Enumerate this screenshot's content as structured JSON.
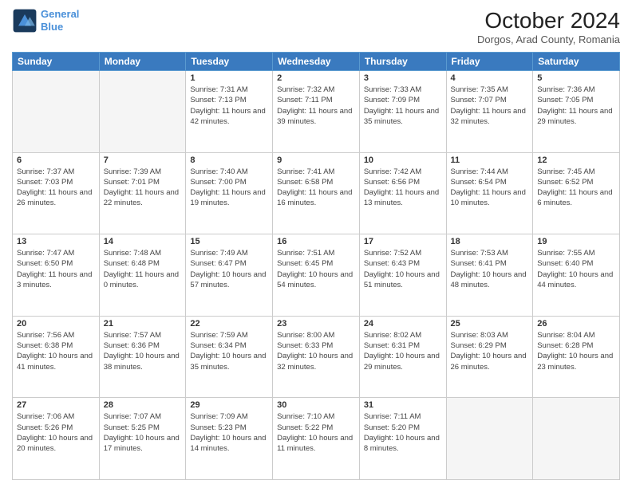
{
  "header": {
    "logo_line1": "General",
    "logo_line2": "Blue",
    "month_title": "October 2024",
    "subtitle": "Dorgos, Arad County, Romania"
  },
  "days_of_week": [
    "Sunday",
    "Monday",
    "Tuesday",
    "Wednesday",
    "Thursday",
    "Friday",
    "Saturday"
  ],
  "weeks": [
    [
      {
        "day": "",
        "info": ""
      },
      {
        "day": "",
        "info": ""
      },
      {
        "day": "1",
        "info": "Sunrise: 7:31 AM\nSunset: 7:13 PM\nDaylight: 11 hours and 42 minutes."
      },
      {
        "day": "2",
        "info": "Sunrise: 7:32 AM\nSunset: 7:11 PM\nDaylight: 11 hours and 39 minutes."
      },
      {
        "day": "3",
        "info": "Sunrise: 7:33 AM\nSunset: 7:09 PM\nDaylight: 11 hours and 35 minutes."
      },
      {
        "day": "4",
        "info": "Sunrise: 7:35 AM\nSunset: 7:07 PM\nDaylight: 11 hours and 32 minutes."
      },
      {
        "day": "5",
        "info": "Sunrise: 7:36 AM\nSunset: 7:05 PM\nDaylight: 11 hours and 29 minutes."
      }
    ],
    [
      {
        "day": "6",
        "info": "Sunrise: 7:37 AM\nSunset: 7:03 PM\nDaylight: 11 hours and 26 minutes."
      },
      {
        "day": "7",
        "info": "Sunrise: 7:39 AM\nSunset: 7:01 PM\nDaylight: 11 hours and 22 minutes."
      },
      {
        "day": "8",
        "info": "Sunrise: 7:40 AM\nSunset: 7:00 PM\nDaylight: 11 hours and 19 minutes."
      },
      {
        "day": "9",
        "info": "Sunrise: 7:41 AM\nSunset: 6:58 PM\nDaylight: 11 hours and 16 minutes."
      },
      {
        "day": "10",
        "info": "Sunrise: 7:42 AM\nSunset: 6:56 PM\nDaylight: 11 hours and 13 minutes."
      },
      {
        "day": "11",
        "info": "Sunrise: 7:44 AM\nSunset: 6:54 PM\nDaylight: 11 hours and 10 minutes."
      },
      {
        "day": "12",
        "info": "Sunrise: 7:45 AM\nSunset: 6:52 PM\nDaylight: 11 hours and 6 minutes."
      }
    ],
    [
      {
        "day": "13",
        "info": "Sunrise: 7:47 AM\nSunset: 6:50 PM\nDaylight: 11 hours and 3 minutes."
      },
      {
        "day": "14",
        "info": "Sunrise: 7:48 AM\nSunset: 6:48 PM\nDaylight: 11 hours and 0 minutes."
      },
      {
        "day": "15",
        "info": "Sunrise: 7:49 AM\nSunset: 6:47 PM\nDaylight: 10 hours and 57 minutes."
      },
      {
        "day": "16",
        "info": "Sunrise: 7:51 AM\nSunset: 6:45 PM\nDaylight: 10 hours and 54 minutes."
      },
      {
        "day": "17",
        "info": "Sunrise: 7:52 AM\nSunset: 6:43 PM\nDaylight: 10 hours and 51 minutes."
      },
      {
        "day": "18",
        "info": "Sunrise: 7:53 AM\nSunset: 6:41 PM\nDaylight: 10 hours and 48 minutes."
      },
      {
        "day": "19",
        "info": "Sunrise: 7:55 AM\nSunset: 6:40 PM\nDaylight: 10 hours and 44 minutes."
      }
    ],
    [
      {
        "day": "20",
        "info": "Sunrise: 7:56 AM\nSunset: 6:38 PM\nDaylight: 10 hours and 41 minutes."
      },
      {
        "day": "21",
        "info": "Sunrise: 7:57 AM\nSunset: 6:36 PM\nDaylight: 10 hours and 38 minutes."
      },
      {
        "day": "22",
        "info": "Sunrise: 7:59 AM\nSunset: 6:34 PM\nDaylight: 10 hours and 35 minutes."
      },
      {
        "day": "23",
        "info": "Sunrise: 8:00 AM\nSunset: 6:33 PM\nDaylight: 10 hours and 32 minutes."
      },
      {
        "day": "24",
        "info": "Sunrise: 8:02 AM\nSunset: 6:31 PM\nDaylight: 10 hours and 29 minutes."
      },
      {
        "day": "25",
        "info": "Sunrise: 8:03 AM\nSunset: 6:29 PM\nDaylight: 10 hours and 26 minutes."
      },
      {
        "day": "26",
        "info": "Sunrise: 8:04 AM\nSunset: 6:28 PM\nDaylight: 10 hours and 23 minutes."
      }
    ],
    [
      {
        "day": "27",
        "info": "Sunrise: 7:06 AM\nSunset: 5:26 PM\nDaylight: 10 hours and 20 minutes."
      },
      {
        "day": "28",
        "info": "Sunrise: 7:07 AM\nSunset: 5:25 PM\nDaylight: 10 hours and 17 minutes."
      },
      {
        "day": "29",
        "info": "Sunrise: 7:09 AM\nSunset: 5:23 PM\nDaylight: 10 hours and 14 minutes."
      },
      {
        "day": "30",
        "info": "Sunrise: 7:10 AM\nSunset: 5:22 PM\nDaylight: 10 hours and 11 minutes."
      },
      {
        "day": "31",
        "info": "Sunrise: 7:11 AM\nSunset: 5:20 PM\nDaylight: 10 hours and 8 minutes."
      },
      {
        "day": "",
        "info": ""
      },
      {
        "day": "",
        "info": ""
      }
    ]
  ]
}
